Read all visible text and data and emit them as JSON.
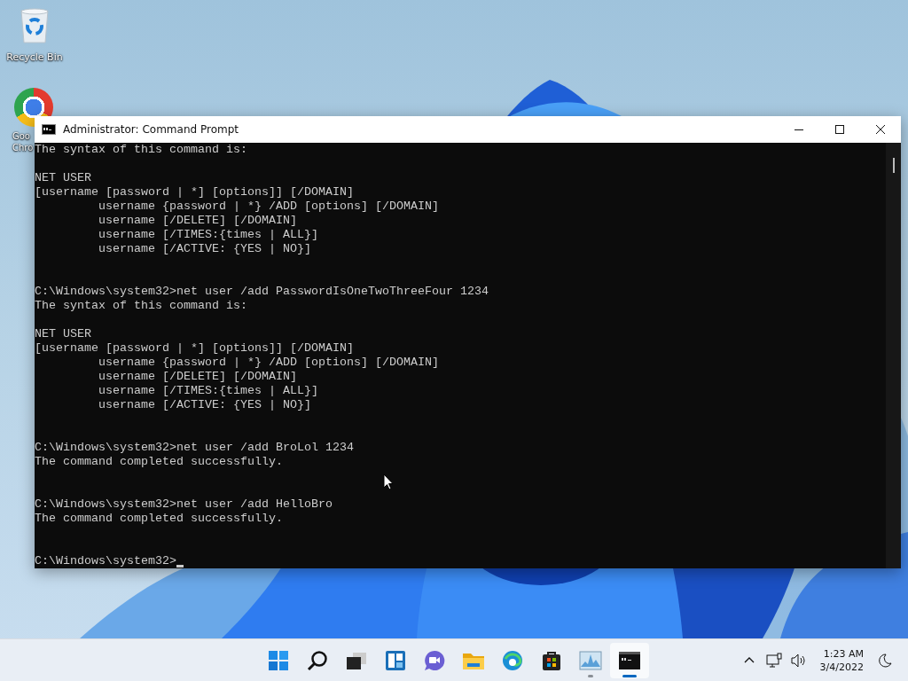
{
  "desktop_icons": [
    {
      "kind": "recycle-bin",
      "label_lines": [
        "Recycle Bin"
      ]
    },
    {
      "kind": "browser",
      "label_lines": [
        "Goo",
        "Chro"
      ]
    }
  ],
  "window": {
    "title": "Administrator: Command Prompt",
    "console_lines": [
      {
        "kind": "text",
        "text": "The syntax of this command is:"
      },
      {
        "kind": "blank"
      },
      {
        "kind": "text",
        "text": "NET USER"
      },
      {
        "kind": "text",
        "text": "[username [password | *] [options]] [/DOMAIN]"
      },
      {
        "kind": "text",
        "text": "         username {password | *} /ADD [options] [/DOMAIN]"
      },
      {
        "kind": "text",
        "text": "         username [/DELETE] [/DOMAIN]"
      },
      {
        "kind": "text",
        "text": "         username [/TIMES:{times | ALL}]"
      },
      {
        "kind": "text",
        "text": "         username [/ACTIVE: {YES | NO}]"
      },
      {
        "kind": "blank"
      },
      {
        "kind": "blank"
      },
      {
        "kind": "text",
        "text": "C:\\Windows\\system32>net user /add PasswordIsOneTwoThreeFour 1234"
      },
      {
        "kind": "text",
        "text": "The syntax of this command is:"
      },
      {
        "kind": "blank"
      },
      {
        "kind": "text",
        "text": "NET USER"
      },
      {
        "kind": "text",
        "text": "[username [password | *] [options]] [/DOMAIN]"
      },
      {
        "kind": "text",
        "text": "         username {password | *} /ADD [options] [/DOMAIN]"
      },
      {
        "kind": "text",
        "text": "         username [/DELETE] [/DOMAIN]"
      },
      {
        "kind": "text",
        "text": "         username [/TIMES:{times | ALL}]"
      },
      {
        "kind": "text",
        "text": "         username [/ACTIVE: {YES | NO}]"
      },
      {
        "kind": "blank"
      },
      {
        "kind": "blank"
      },
      {
        "kind": "text",
        "text": "C:\\Windows\\system32>net user /add BroLol 1234"
      },
      {
        "kind": "text",
        "text": "The command completed successfully."
      },
      {
        "kind": "blank"
      },
      {
        "kind": "blank"
      },
      {
        "kind": "text",
        "text": "C:\\Windows\\system32>net user /add HelloBro"
      },
      {
        "kind": "text",
        "text": "The command completed successfully."
      },
      {
        "kind": "blank"
      },
      {
        "kind": "blank"
      },
      {
        "kind": "prompt",
        "text": "C:\\Windows\\system32>"
      }
    ]
  },
  "taskbar": {
    "items": [
      {
        "kind": "start",
        "running": false,
        "active": false
      },
      {
        "kind": "search",
        "running": false,
        "active": false
      },
      {
        "kind": "task-view",
        "running": false,
        "active": false
      },
      {
        "kind": "widgets",
        "running": false,
        "active": false
      },
      {
        "kind": "chat",
        "running": false,
        "active": false
      },
      {
        "kind": "folder",
        "running": false,
        "active": false
      },
      {
        "kind": "browser",
        "running": false,
        "active": false
      },
      {
        "kind": "store",
        "running": false,
        "active": false
      },
      {
        "kind": "monitor",
        "running": true,
        "active": false
      },
      {
        "kind": "terminal",
        "running": true,
        "active": true
      }
    ],
    "clock": {
      "time": "1:23 AM",
      "date": "3/4/2022"
    }
  }
}
